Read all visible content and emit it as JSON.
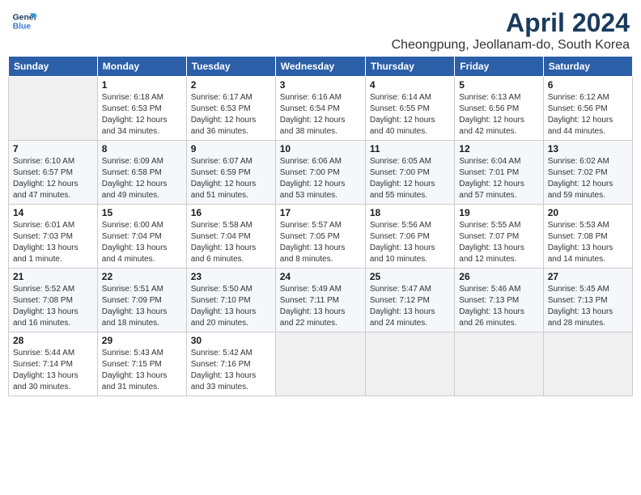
{
  "logo": {
    "line1": "General",
    "line2": "Blue"
  },
  "title": "April 2024",
  "subtitle": "Cheongpung, Jeollanam-do, South Korea",
  "weekdays": [
    "Sunday",
    "Monday",
    "Tuesday",
    "Wednesday",
    "Thursday",
    "Friday",
    "Saturday"
  ],
  "weeks": [
    [
      {
        "day": "",
        "info": ""
      },
      {
        "day": "1",
        "info": "Sunrise: 6:18 AM\nSunset: 6:53 PM\nDaylight: 12 hours\nand 34 minutes."
      },
      {
        "day": "2",
        "info": "Sunrise: 6:17 AM\nSunset: 6:53 PM\nDaylight: 12 hours\nand 36 minutes."
      },
      {
        "day": "3",
        "info": "Sunrise: 6:16 AM\nSunset: 6:54 PM\nDaylight: 12 hours\nand 38 minutes."
      },
      {
        "day": "4",
        "info": "Sunrise: 6:14 AM\nSunset: 6:55 PM\nDaylight: 12 hours\nand 40 minutes."
      },
      {
        "day": "5",
        "info": "Sunrise: 6:13 AM\nSunset: 6:56 PM\nDaylight: 12 hours\nand 42 minutes."
      },
      {
        "day": "6",
        "info": "Sunrise: 6:12 AM\nSunset: 6:56 PM\nDaylight: 12 hours\nand 44 minutes."
      }
    ],
    [
      {
        "day": "7",
        "info": "Sunrise: 6:10 AM\nSunset: 6:57 PM\nDaylight: 12 hours\nand 47 minutes."
      },
      {
        "day": "8",
        "info": "Sunrise: 6:09 AM\nSunset: 6:58 PM\nDaylight: 12 hours\nand 49 minutes."
      },
      {
        "day": "9",
        "info": "Sunrise: 6:07 AM\nSunset: 6:59 PM\nDaylight: 12 hours\nand 51 minutes."
      },
      {
        "day": "10",
        "info": "Sunrise: 6:06 AM\nSunset: 7:00 PM\nDaylight: 12 hours\nand 53 minutes."
      },
      {
        "day": "11",
        "info": "Sunrise: 6:05 AM\nSunset: 7:00 PM\nDaylight: 12 hours\nand 55 minutes."
      },
      {
        "day": "12",
        "info": "Sunrise: 6:04 AM\nSunset: 7:01 PM\nDaylight: 12 hours\nand 57 minutes."
      },
      {
        "day": "13",
        "info": "Sunrise: 6:02 AM\nSunset: 7:02 PM\nDaylight: 12 hours\nand 59 minutes."
      }
    ],
    [
      {
        "day": "14",
        "info": "Sunrise: 6:01 AM\nSunset: 7:03 PM\nDaylight: 13 hours\nand 1 minute."
      },
      {
        "day": "15",
        "info": "Sunrise: 6:00 AM\nSunset: 7:04 PM\nDaylight: 13 hours\nand 4 minutes."
      },
      {
        "day": "16",
        "info": "Sunrise: 5:58 AM\nSunset: 7:04 PM\nDaylight: 13 hours\nand 6 minutes."
      },
      {
        "day": "17",
        "info": "Sunrise: 5:57 AM\nSunset: 7:05 PM\nDaylight: 13 hours\nand 8 minutes."
      },
      {
        "day": "18",
        "info": "Sunrise: 5:56 AM\nSunset: 7:06 PM\nDaylight: 13 hours\nand 10 minutes."
      },
      {
        "day": "19",
        "info": "Sunrise: 5:55 AM\nSunset: 7:07 PM\nDaylight: 13 hours\nand 12 minutes."
      },
      {
        "day": "20",
        "info": "Sunrise: 5:53 AM\nSunset: 7:08 PM\nDaylight: 13 hours\nand 14 minutes."
      }
    ],
    [
      {
        "day": "21",
        "info": "Sunrise: 5:52 AM\nSunset: 7:08 PM\nDaylight: 13 hours\nand 16 minutes."
      },
      {
        "day": "22",
        "info": "Sunrise: 5:51 AM\nSunset: 7:09 PM\nDaylight: 13 hours\nand 18 minutes."
      },
      {
        "day": "23",
        "info": "Sunrise: 5:50 AM\nSunset: 7:10 PM\nDaylight: 13 hours\nand 20 minutes."
      },
      {
        "day": "24",
        "info": "Sunrise: 5:49 AM\nSunset: 7:11 PM\nDaylight: 13 hours\nand 22 minutes."
      },
      {
        "day": "25",
        "info": "Sunrise: 5:47 AM\nSunset: 7:12 PM\nDaylight: 13 hours\nand 24 minutes."
      },
      {
        "day": "26",
        "info": "Sunrise: 5:46 AM\nSunset: 7:13 PM\nDaylight: 13 hours\nand 26 minutes."
      },
      {
        "day": "27",
        "info": "Sunrise: 5:45 AM\nSunset: 7:13 PM\nDaylight: 13 hours\nand 28 minutes."
      }
    ],
    [
      {
        "day": "28",
        "info": "Sunrise: 5:44 AM\nSunset: 7:14 PM\nDaylight: 13 hours\nand 30 minutes."
      },
      {
        "day": "29",
        "info": "Sunrise: 5:43 AM\nSunset: 7:15 PM\nDaylight: 13 hours\nand 31 minutes."
      },
      {
        "day": "30",
        "info": "Sunrise: 5:42 AM\nSunset: 7:16 PM\nDaylight: 13 hours\nand 33 minutes."
      },
      {
        "day": "",
        "info": ""
      },
      {
        "day": "",
        "info": ""
      },
      {
        "day": "",
        "info": ""
      },
      {
        "day": "",
        "info": ""
      }
    ]
  ]
}
